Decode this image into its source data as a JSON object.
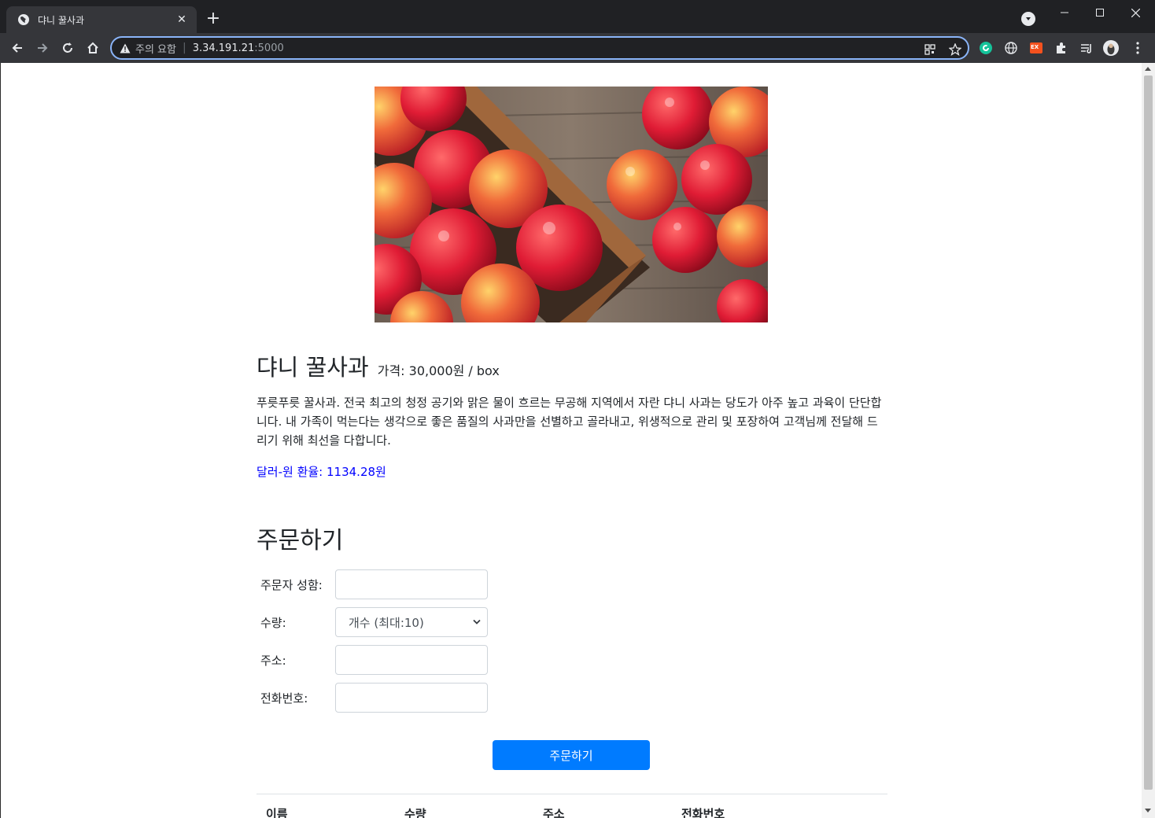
{
  "browser": {
    "tab_title": "댜니 꿀사과",
    "new_tab_symbol": "+",
    "close_symbol": "✕",
    "security_label": "주의 요함",
    "url_host": "3.34.191.21",
    "url_port": ":5000",
    "separator": "|",
    "extensions": [
      "grammarly-icon",
      "translate-icon",
      "ex-icon",
      "puzzle-icon",
      "reading-list-icon",
      "profile-avatar",
      "menu-icon"
    ],
    "ex_label": "EX"
  },
  "product": {
    "name": "댜니 꿀사과",
    "price_label": "가격: 30,000원 / box",
    "description": "푸릇푸릇 꿀사과. 전국 최고의 청정 공기와 맑은 물이 흐르는 무공해 지역에서 자란 댜니 사과는 당도가 아주 높고 과육이 단단합니다. 내 가족이 먹는다는 생각으로 좋은 품질의 사과만을 선별하고 골라내고, 위생적으로 관리 및 포장하여 고객님께 전달해 드리기 위해 최선을 다합니다.",
    "exchange_rate": "달러-원 환율: 1134.28원"
  },
  "order": {
    "title": "주문하기",
    "name_label": "주문자 성함:",
    "qty_label": "수량:",
    "qty_selected": "개수 (최대:10)",
    "address_label": "주소:",
    "phone_label": "전화번호:",
    "submit_label": "주문하기"
  },
  "table": {
    "headers": [
      "이름",
      "수량",
      "주소",
      "전화번호"
    ]
  },
  "colors": {
    "accent": "#007bff",
    "rate_text": "#0000ff",
    "omnibox_focus": "#8ab4f8"
  }
}
